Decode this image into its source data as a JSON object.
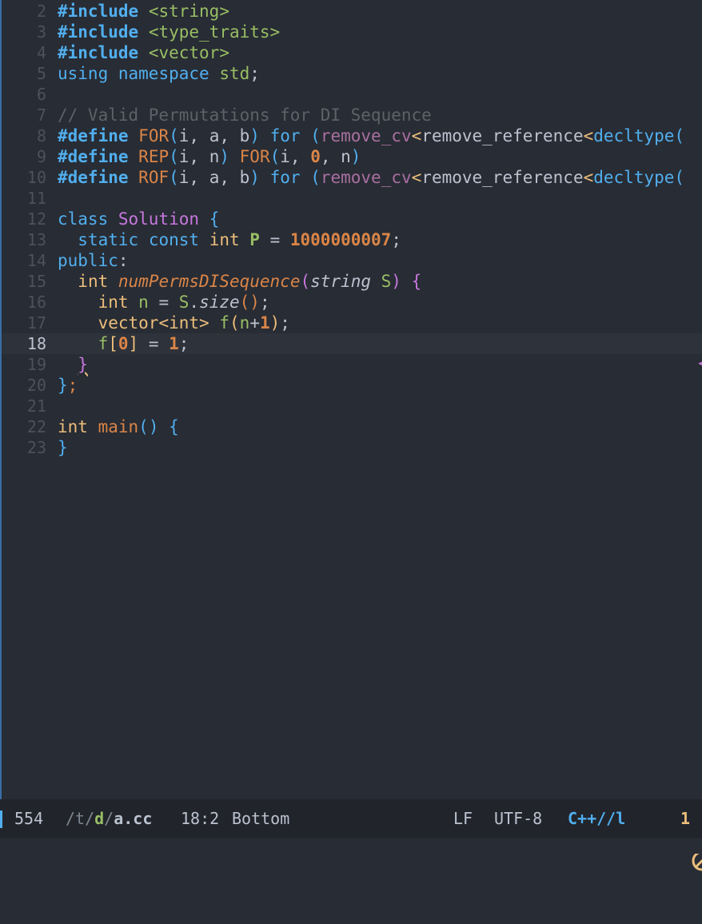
{
  "editor": {
    "lines": [
      {
        "num": "2",
        "tokens": [
          [
            "#include",
            "macro"
          ],
          [
            " ",
            ""
          ],
          [
            "<string>",
            "include-path"
          ]
        ]
      },
      {
        "num": "3",
        "tokens": [
          [
            "#include",
            "macro"
          ],
          [
            " ",
            ""
          ],
          [
            "<type_traits>",
            "include-path"
          ]
        ]
      },
      {
        "num": "4",
        "tokens": [
          [
            "#include",
            "macro"
          ],
          [
            " ",
            ""
          ],
          [
            "<vector>",
            "include-path"
          ]
        ]
      },
      {
        "num": "5",
        "tokens": [
          [
            "using",
            "kw"
          ],
          [
            " ",
            ""
          ],
          [
            "namespace",
            "kw"
          ],
          [
            " ",
            ""
          ],
          [
            "std",
            "ns"
          ],
          [
            ";",
            "punct"
          ]
        ]
      },
      {
        "num": "6",
        "tokens": []
      },
      {
        "num": "7",
        "tokens": [
          [
            "// Valid Permutations for DI Sequence",
            "comment"
          ]
        ]
      },
      {
        "num": "8",
        "tokens": [
          [
            "#define",
            "macro"
          ],
          [
            " ",
            ""
          ],
          [
            "FOR",
            "macro-name"
          ],
          [
            "(",
            "paren"
          ],
          [
            "i, a, b",
            "punct"
          ],
          [
            ")",
            "paren"
          ],
          [
            " ",
            ""
          ],
          [
            "for",
            "kw"
          ],
          [
            " ",
            ""
          ],
          [
            "(",
            "paren"
          ],
          [
            "remove_cv",
            "removecv"
          ],
          [
            "<",
            "type"
          ],
          [
            "remove_reference",
            "punct"
          ],
          [
            "<",
            "type"
          ],
          [
            "decltype",
            "kw"
          ],
          [
            "(",
            "paren"
          ]
        ]
      },
      {
        "num": "9",
        "tokens": [
          [
            "#define",
            "macro"
          ],
          [
            " ",
            ""
          ],
          [
            "REP",
            "macro-name"
          ],
          [
            "(",
            "paren"
          ],
          [
            "i, n",
            "punct"
          ],
          [
            ")",
            "paren"
          ],
          [
            " ",
            ""
          ],
          [
            "FOR",
            "macro-name"
          ],
          [
            "(",
            "paren"
          ],
          [
            "i, ",
            "punct"
          ],
          [
            "0",
            "num"
          ],
          [
            ", n",
            "punct"
          ],
          [
            ")",
            "paren"
          ]
        ]
      },
      {
        "num": "10",
        "tokens": [
          [
            "#define",
            "macro"
          ],
          [
            " ",
            ""
          ],
          [
            "ROF",
            "macro-name"
          ],
          [
            "(",
            "paren"
          ],
          [
            "i, a, b",
            "punct"
          ],
          [
            ")",
            "paren"
          ],
          [
            " ",
            ""
          ],
          [
            "for",
            "kw"
          ],
          [
            " ",
            ""
          ],
          [
            "(",
            "paren"
          ],
          [
            "remove_cv",
            "removecv"
          ],
          [
            "<",
            "type"
          ],
          [
            "remove_reference",
            "punct"
          ],
          [
            "<",
            "type"
          ],
          [
            "decltype",
            "kw"
          ],
          [
            "(",
            "paren"
          ]
        ]
      },
      {
        "num": "11",
        "tokens": []
      },
      {
        "num": "12",
        "tokens": [
          [
            "class",
            "kw"
          ],
          [
            " ",
            ""
          ],
          [
            "Solution",
            "class"
          ],
          [
            " ",
            ""
          ],
          [
            "{",
            "paren"
          ]
        ]
      },
      {
        "num": "13",
        "tokens": [
          [
            "  ",
            ""
          ],
          [
            "static",
            "kw"
          ],
          [
            " ",
            ""
          ],
          [
            "const",
            "kw"
          ],
          [
            " ",
            ""
          ],
          [
            "int",
            "type"
          ],
          [
            " ",
            ""
          ],
          [
            "P",
            "const"
          ],
          [
            " = ",
            "punct"
          ],
          [
            "1000000007",
            "num"
          ],
          [
            ";",
            "punct"
          ]
        ]
      },
      {
        "num": "14",
        "tokens": [
          [
            "public",
            "kw"
          ],
          [
            ":",
            "punct"
          ]
        ]
      },
      {
        "num": "15",
        "tokens": [
          [
            "  ",
            ""
          ],
          [
            "int",
            "type"
          ],
          [
            " ",
            ""
          ],
          [
            "numPermsDISequence",
            "fn"
          ],
          [
            "(",
            "bracket1"
          ],
          [
            "string",
            "method"
          ],
          [
            " ",
            ""
          ],
          [
            "S",
            "var"
          ],
          [
            ")",
            "bracket1"
          ],
          [
            " ",
            ""
          ],
          [
            "{",
            "bracket1"
          ]
        ]
      },
      {
        "num": "16",
        "tokens": [
          [
            "    ",
            ""
          ],
          [
            "int",
            "type"
          ],
          [
            " ",
            ""
          ],
          [
            "n",
            "var"
          ],
          [
            " = ",
            "punct"
          ],
          [
            "S",
            "var"
          ],
          [
            ".",
            "punct"
          ],
          [
            "size",
            "method"
          ],
          [
            "()",
            "paren-orange"
          ],
          [
            ";",
            "punct"
          ]
        ]
      },
      {
        "num": "17",
        "tokens": [
          [
            "    ",
            ""
          ],
          [
            "vector",
            "type"
          ],
          [
            "<",
            "type"
          ],
          [
            "int",
            "type"
          ],
          [
            ">",
            "type"
          ],
          [
            " ",
            ""
          ],
          [
            "f",
            "var"
          ],
          [
            "(",
            "type"
          ],
          [
            "n",
            "var"
          ],
          [
            "+",
            "punct"
          ],
          [
            "1",
            "num"
          ],
          [
            ")",
            "type"
          ],
          [
            ";",
            "punct"
          ]
        ]
      },
      {
        "num": "18",
        "current": true,
        "tokens": [
          [
            "    ",
            ""
          ],
          [
            "f",
            "var"
          ],
          [
            "[",
            "type"
          ],
          [
            "0",
            "num"
          ],
          [
            "]",
            "type"
          ],
          [
            " = ",
            "punct"
          ],
          [
            "1",
            "num"
          ],
          [
            ";",
            "punct"
          ]
        ]
      },
      {
        "num": "19",
        "tokens": [
          [
            "  ",
            ""
          ],
          [
            "}",
            "squiggle-bracket"
          ]
        ]
      },
      {
        "num": "20",
        "tokens": [
          [
            "}",
            "paren"
          ],
          [
            ";",
            "paren-orange"
          ]
        ]
      },
      {
        "num": "21",
        "tokens": []
      },
      {
        "num": "22",
        "tokens": [
          [
            "int",
            "type"
          ],
          [
            " ",
            ""
          ],
          [
            "main",
            "fn-main"
          ],
          [
            "()",
            "paren"
          ],
          [
            " ",
            ""
          ],
          [
            "{",
            "paren"
          ]
        ]
      },
      {
        "num": "23",
        "tokens": [
          [
            "}",
            "paren"
          ]
        ]
      }
    ]
  },
  "modeline": {
    "size": "554",
    "path_dir1": "/t/",
    "path_dir2": "d",
    "path_sep": "/",
    "file_name": "a.cc",
    "position": "18:2",
    "scroll": "Bottom",
    "eol": "LF",
    "encoding": "UTF-8",
    "mode": "C++//l",
    "warning_icon": "prohibited-circle-icon",
    "warning_count": "1"
  },
  "colors": {
    "background": "#282c34",
    "modeline_bg": "#21242b",
    "accent_blue": "#51afef",
    "orange": "#da8548",
    "green": "#98be65",
    "yellow": "#ecbe7b",
    "magenta": "#c678dd"
  }
}
